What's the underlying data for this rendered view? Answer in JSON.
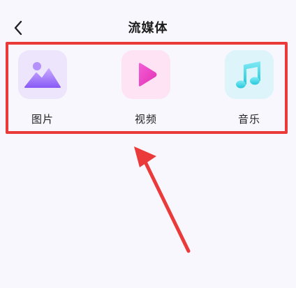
{
  "header": {
    "title": "流媒体"
  },
  "media_types": [
    {
      "label": "图片",
      "icon": "image-icon"
    },
    {
      "label": "视频",
      "icon": "play-icon"
    },
    {
      "label": "音乐",
      "icon": "music-note-icon"
    }
  ],
  "colors": {
    "annotation_red": "#ea3a3a",
    "photo_tile_bg": "#ece5fc",
    "video_tile_bg": "#fde3f3",
    "music_tile_bg": "#ddf4fb"
  }
}
